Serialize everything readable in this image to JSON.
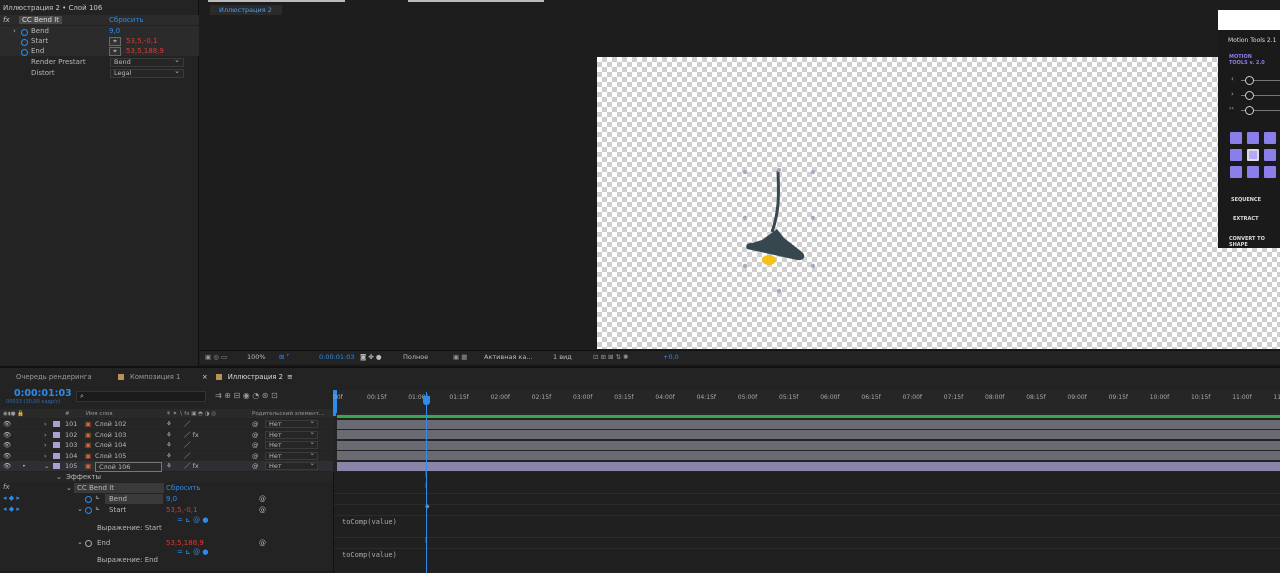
{
  "effect_controls": {
    "title": "Иллюстрация 2 • Слой 106",
    "effect_name": "CC Bend It",
    "reset": "Сбросить",
    "props": [
      {
        "label": "Bend",
        "value": "9,0"
      },
      {
        "label": "Start",
        "value": "53,5,-0,1"
      },
      {
        "label": "End",
        "value": "53,5,188,9"
      },
      {
        "label": "Render Prestart",
        "value": "Bend"
      },
      {
        "label": "Distort",
        "value": "Legal"
      }
    ]
  },
  "viewer": {
    "tab": "Иллюстрация 2",
    "toolbar": {
      "zoom": "100%",
      "time": "0:00:01:03",
      "quality": "Полное",
      "camera": "Активная ка...",
      "views": "1 вид",
      "exposure": "+0,0"
    }
  },
  "motion_tools": {
    "title": "Motion Tools 2.1",
    "subtitle": "MOTION TOOLS v. 2.0",
    "sequence": "SEQUENCE",
    "extract": "EXTRACT",
    "convert": "CONVERT TO SHAPE",
    "slider_icons": [
      "‹",
      "›",
      "›‹"
    ]
  },
  "timeline": {
    "tabs": [
      "Очередь рендеринга",
      "Композиция 1",
      "Иллюстрация 2"
    ],
    "timecode": "0:00:01:03",
    "fps": "00033 (30,00 кадр/с)",
    "headers": {
      "num": "#",
      "name": "Имя слоя",
      "parent": "Родительский элемент..."
    },
    "ruler": [
      "00f",
      "00:15f",
      "01:00f",
      "01:15f",
      "02:00f",
      "02:15f",
      "03:00f",
      "03:15f",
      "04:00f",
      "04:15f",
      "05:00f",
      "05:15f",
      "06:00f",
      "06:15f",
      "07:00f",
      "07:15f",
      "08:00f",
      "08:15f",
      "09:00f",
      "09:15f",
      "10:00f",
      "10:15f",
      "11:00f",
      "11"
    ],
    "layers": [
      {
        "num": "101",
        "name": "Слой 102",
        "parent": "Нет"
      },
      {
        "num": "102",
        "name": "Слой 103",
        "parent": "Нет"
      },
      {
        "num": "103",
        "name": "Слой 104",
        "parent": "Нет"
      },
      {
        "num": "104",
        "name": "Слой 105",
        "parent": "Нет"
      },
      {
        "num": "105",
        "name": "Слой 106",
        "parent": "Нет"
      }
    ],
    "effects_label": "Эффекты",
    "effect_name": "CC Bend It",
    "reset": "Сбросить",
    "sub": [
      {
        "label": "Bend",
        "value": "9,0"
      },
      {
        "label": "Start",
        "value": "53,5,-0,1"
      },
      {
        "label": "Выражение: Start",
        "value": ""
      },
      {
        "label": "End",
        "value": "53,5,188,9"
      },
      {
        "label": "Выражение: End",
        "value": ""
      }
    ],
    "expression_1": "toComp(value)",
    "expression_2": "toComp(value)"
  }
}
